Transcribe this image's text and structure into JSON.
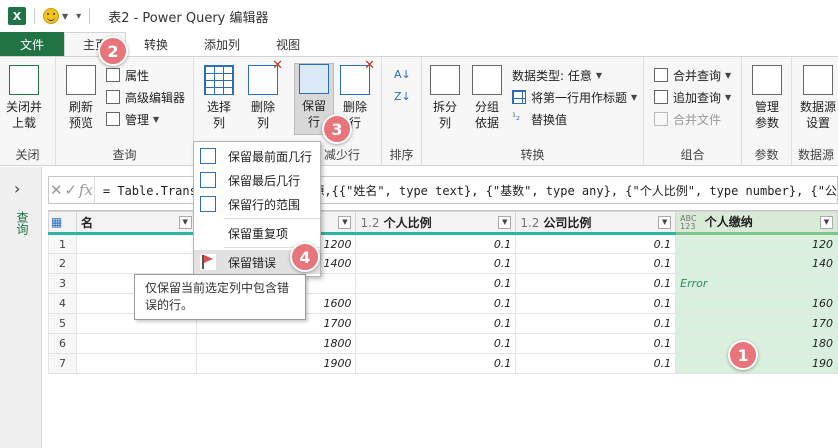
{
  "window": {
    "title": "表2 - Power Query 编辑器",
    "app_icon": "X"
  },
  "tabs": [
    "文件",
    "主页",
    "转换",
    "添加列",
    "视图"
  ],
  "ribbon": {
    "close_group": {
      "button": "关闭并\n上载",
      "label": "关闭"
    },
    "query_group": {
      "refresh": "刷新\n预览",
      "properties": "属性",
      "advanced_editor": "高级编辑器",
      "manage": "管理",
      "label": "查询"
    },
    "select_columns": "选择\n列",
    "remove_columns": "删除\n列",
    "keep_rows": "保留\n行",
    "remove_rows": "删除\n行",
    "reduce_rows_label": "减少行",
    "sort_label": "排序",
    "split_column": "拆分\n列",
    "group_by": "分组\n依据",
    "data_type": "数据类型: 任意",
    "use_first_row": "将第一行用作标题",
    "replace_values": "替换值",
    "transform_label": "转换",
    "merge_queries": "合并查询",
    "append_queries": "追加查询",
    "combine_files": "合并文件",
    "combine_label": "组合",
    "manage_params": "管理\n参数",
    "params_label": "参数",
    "datasource_settings": "数据源\n设置",
    "datasource_label": "数据源"
  },
  "leftpane": {
    "label": "查询"
  },
  "formula": {
    "text": "= Table.TransformColumnTypes(源,{{\"姓名\", type text}, {\"基数\", type any}, {\"个人比例\", type number}, {\"公"
  },
  "table": {
    "columns": [
      {
        "name": "名",
        "type": ""
      },
      {
        "name": "",
        "type": ""
      },
      {
        "name": "个人比例",
        "type": "1.2"
      },
      {
        "name": "公司比例",
        "type": "1.2"
      },
      {
        "name": "个人缴纳",
        "type": "ABC\n123"
      }
    ],
    "rows": [
      {
        "rn": "1",
        "base": "1200",
        "pr": "0.1",
        "cr": "0.1",
        "pay": "120"
      },
      {
        "rn": "2",
        "base": "1400",
        "pr": "0.1",
        "cr": "0.1",
        "pay": "140"
      },
      {
        "rn": "3",
        "base": "",
        "pr": "0.1",
        "cr": "0.1",
        "pay": "Error"
      },
      {
        "rn": "4",
        "base": "1600",
        "pr": "0.1",
        "cr": "0.1",
        "pay": "160"
      },
      {
        "rn": "5",
        "base": "1700",
        "pr": "0.1",
        "cr": "0.1",
        "pay": "170"
      },
      {
        "rn": "6",
        "base": "1800",
        "pr": "0.1",
        "cr": "0.1",
        "pay": "180"
      },
      {
        "rn": "7",
        "base": "1900",
        "pr": "0.1",
        "cr": "0.1",
        "pay": "190"
      }
    ]
  },
  "menu": {
    "items": [
      "保留最前面几行",
      "保留最后几行",
      "保留行的范围",
      "保留重复项",
      "保留错误"
    ]
  },
  "tooltip": "仅保留当前选定列中包含错误的行。",
  "badges": [
    "1",
    "2",
    "3",
    "4"
  ],
  "colors": {
    "excel_green": "#217346",
    "badge": "#e8747c",
    "selected_col": "#d9f0de"
  }
}
